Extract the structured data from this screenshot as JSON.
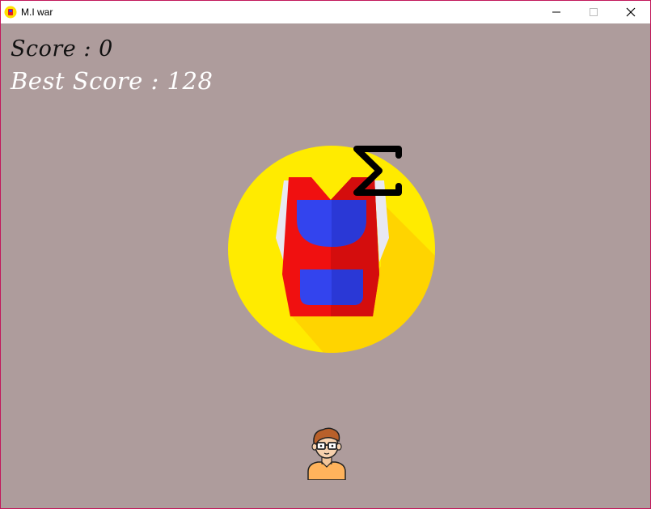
{
  "window": {
    "title": "M.I war",
    "app_icon": "game-app-icon",
    "controls": [
      "minimize-icon",
      "maximize-icon",
      "close-icon"
    ]
  },
  "hud": {
    "score_label": "Score",
    "score_separator": ":",
    "score_value": "0",
    "best_score_label": "Best Score",
    "best_score_separator": ":",
    "best_score_value": "128"
  },
  "scene": {
    "background_color": "#ae9c9c",
    "target_icon": "backpack-icon",
    "enemy_symbol": "Σ",
    "player_icon": "nerd-boy-avatar"
  },
  "colors": {
    "score_text": "#111111",
    "best_score_text": "#ffffff",
    "circle_yellow": "#ffeb00",
    "backpack_red": "#f01010",
    "backpack_blue": "#3344ee"
  }
}
